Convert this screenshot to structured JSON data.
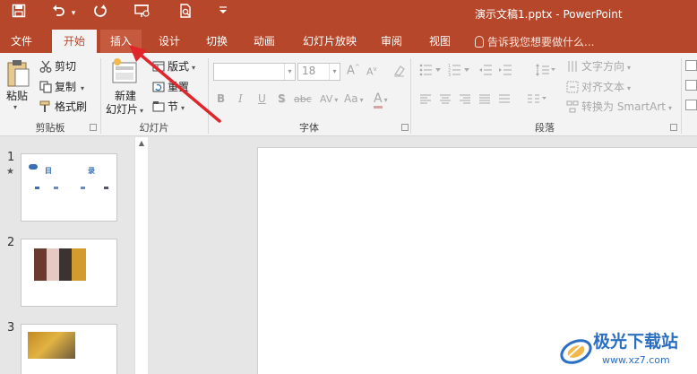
{
  "window": {
    "title": "演示文稿1.pptx - PowerPoint"
  },
  "qat": {
    "save_icon": "save-icon",
    "undo_icon": "undo-icon",
    "redo_icon": "redo-icon",
    "present_icon": "present-from-start-icon",
    "preview_icon": "print-preview-icon",
    "customize_icon": "customize-qat-icon"
  },
  "tabs": [
    {
      "label": "文件"
    },
    {
      "label": "开始"
    },
    {
      "label": "插入"
    },
    {
      "label": "设计"
    },
    {
      "label": "切换"
    },
    {
      "label": "动画"
    },
    {
      "label": "幻灯片放映"
    },
    {
      "label": "审阅"
    },
    {
      "label": "视图"
    }
  ],
  "tell_me": {
    "placeholder": "告诉我您想要做什么..."
  },
  "ribbon": {
    "clipboard": {
      "label": "剪贴板",
      "paste": "粘贴",
      "cut": "剪切",
      "copy": "复制",
      "format_painter": "格式刷"
    },
    "slides": {
      "label": "幻灯片",
      "new_slide_line1": "新建",
      "new_slide_line2": "幻灯片",
      "layout": "版式",
      "reset": "重置",
      "section": "节"
    },
    "font": {
      "label": "字体",
      "font_name": "",
      "font_size": "18",
      "bold": "B",
      "italic": "I",
      "underline": "U",
      "shadow": "S",
      "strike": "abc",
      "spacing": "AV",
      "case": "Aa",
      "grow": "A",
      "shrink": "A",
      "color": "A"
    },
    "paragraph": {
      "label": "段落",
      "text_direction": "文字方向",
      "align_text": "对齐文本",
      "smartart": "转换为 SmartArt"
    }
  },
  "thumbnails": [
    {
      "number": "1",
      "star": "★",
      "title_left": "目",
      "title_right": "录"
    },
    {
      "number": "2"
    },
    {
      "number": "3"
    }
  ],
  "watermark": {
    "title": "极光下载站",
    "url": "www.xz7.com"
  },
  "colors": {
    "accent": "#b7472a",
    "annotation": "#e0262b"
  }
}
